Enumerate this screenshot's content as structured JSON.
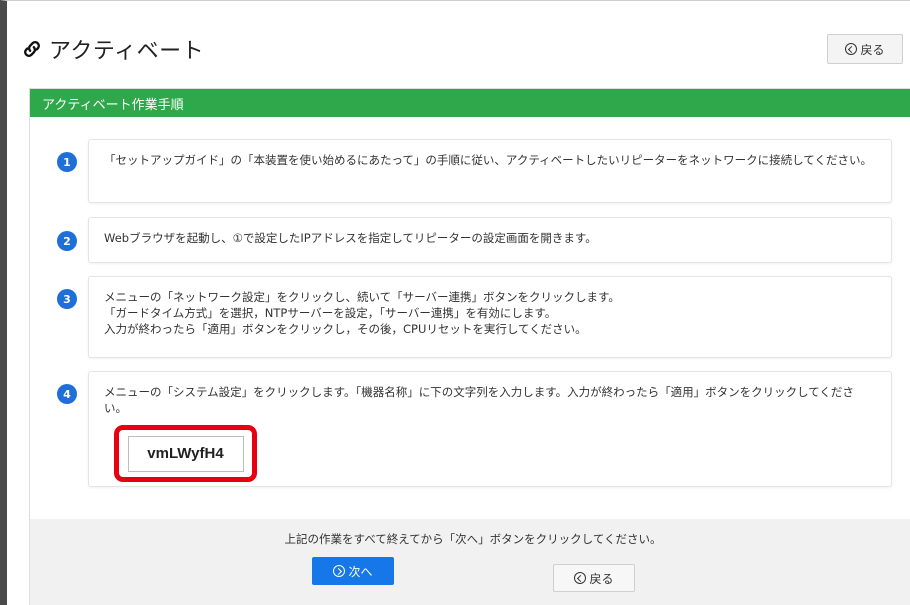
{
  "page": {
    "title": "アクティベート",
    "back_label": "戻る"
  },
  "panel": {
    "header": "アクティベート作業手順"
  },
  "steps": [
    {
      "number": "1",
      "lines": [
        "「セットアップガイド」の「本装置を使い始めるにあたって」の手順に従い、アクティベートしたいリピーターをネットワークに接続してください。"
      ]
    },
    {
      "number": "2",
      "lines": [
        "Webブラウザを起動し、①で設定したIPアドレスを指定してリピーターの設定画面を開きます。"
      ]
    },
    {
      "number": "3",
      "lines": [
        "メニューの「ネットワーク設定」をクリックし、続いて「サーバー連携」ボタンをクリックします。",
        "「ガードタイム方式」を選択，NTPサーバーを設定，「サーバー連携」を有効にします。",
        "入力が終わったら「適用」ボタンをクリックし，その後，CPUリセットを実行してください。"
      ]
    },
    {
      "number": "4",
      "lines": [
        "メニューの「システム設定」をクリックします。「機器名称」に下の文字列を入力します。入力が終わったら「適用」ボタンをクリックしてください。"
      ],
      "code": "vmLWyfH4"
    }
  ],
  "footer": {
    "instruction": "上記の作業をすべて終えてから「次へ」ボタンをクリックしてください。",
    "next_label": "次へ",
    "back_label": "戻る"
  },
  "colors": {
    "header_green": "#2ea84a",
    "badge_blue": "#1f6fd8",
    "next_blue": "#1677e8",
    "highlight_red": "#e60012"
  },
  "icons": {
    "title": "link-icon",
    "back": "circle-arrow-left-icon",
    "next": "circle-arrow-right-icon"
  }
}
